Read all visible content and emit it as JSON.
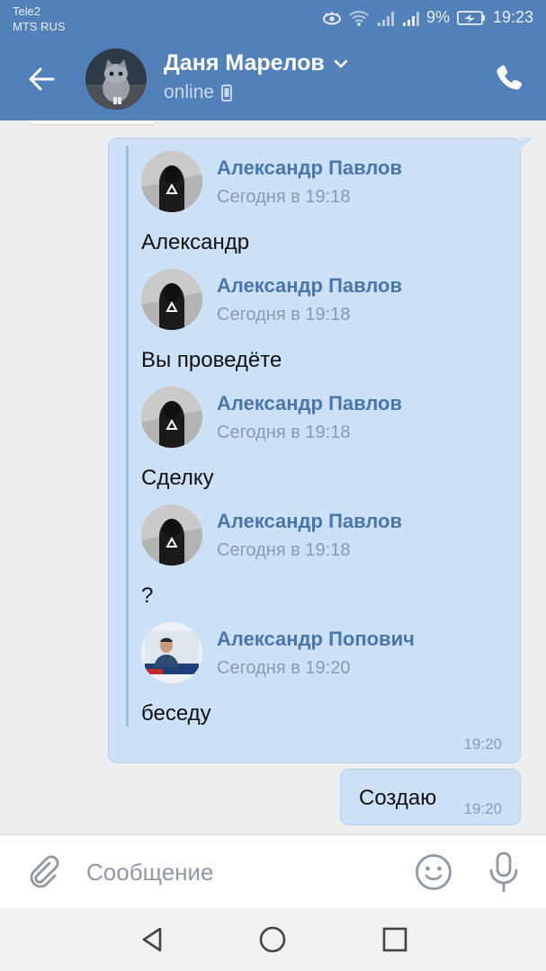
{
  "status_bar": {
    "carrier1": "Tele2",
    "carrier2": "MTS RUS",
    "battery": "9%",
    "time": "19:23"
  },
  "header": {
    "back_icon": "arrow-left-icon",
    "contact_name": "Даня Марелов",
    "status": "online",
    "call_icon": "phone-icon"
  },
  "forwarded_message": {
    "items": [
      {
        "author": "Александр Павлов",
        "time": "Сегодня в 19:18",
        "text": "Александр"
      },
      {
        "author": "Александр Павлов",
        "time": "Сегодня в 19:18",
        "text": "Вы проведёте"
      },
      {
        "author": "Александр Павлов",
        "time": "Сегодня в 19:18",
        "text": "Сделку"
      },
      {
        "author": "Александр Павлов",
        "time": "Сегодня в 19:18",
        "text": "?"
      },
      {
        "author": "Александр Попович",
        "time": "Сегодня в 19:20",
        "text": "беседу"
      }
    ],
    "sent_time": "19:20"
  },
  "own_message": {
    "text": "Создаю",
    "time": "19:20"
  },
  "composer": {
    "placeholder": "Сообщение",
    "value": ""
  },
  "colors": {
    "header": "#5181b8",
    "bubble": "#cce0f7",
    "author": "#4a76a8"
  }
}
